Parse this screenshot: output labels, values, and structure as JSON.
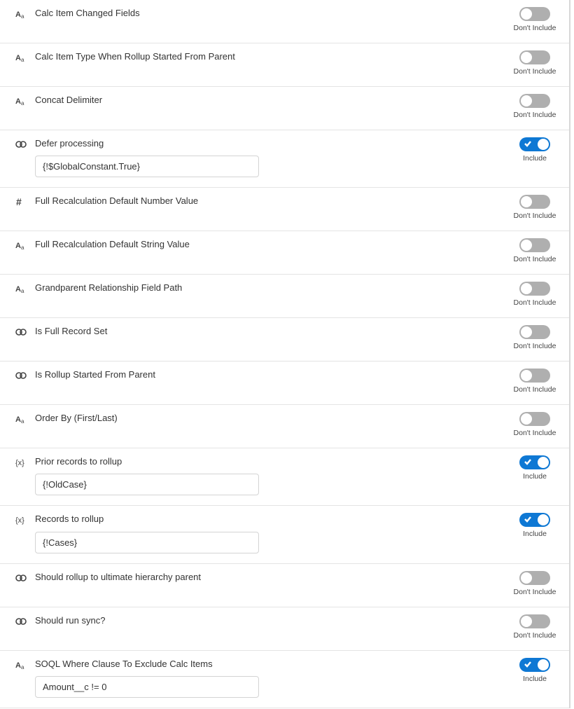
{
  "text": {
    "include": "Include",
    "dont_include": "Don't Include"
  },
  "rows": [
    {
      "icon": "text",
      "label": "Calc Item Changed Fields",
      "included": false,
      "value": null
    },
    {
      "icon": "text",
      "label": "Calc Item Type When Rollup Started From Parent",
      "included": false,
      "value": null
    },
    {
      "icon": "text",
      "label": "Concat Delimiter",
      "included": false,
      "value": null
    },
    {
      "icon": "toggle",
      "label": "Defer processing",
      "included": true,
      "value": "{!$GlobalConstant.True}"
    },
    {
      "icon": "number",
      "label": "Full Recalculation Default Number Value",
      "included": false,
      "value": null
    },
    {
      "icon": "text",
      "label": "Full Recalculation Default String Value",
      "included": false,
      "value": null
    },
    {
      "icon": "text",
      "label": "Grandparent Relationship Field Path",
      "included": false,
      "value": null
    },
    {
      "icon": "toggle",
      "label": "Is Full Record Set",
      "included": false,
      "value": null
    },
    {
      "icon": "toggle",
      "label": "Is Rollup Started From Parent",
      "included": false,
      "value": null
    },
    {
      "icon": "text",
      "label": "Order By (First/Last)",
      "included": false,
      "value": null
    },
    {
      "icon": "formula",
      "label": "Prior records to rollup",
      "included": true,
      "value": "{!OldCase}"
    },
    {
      "icon": "formula",
      "label": "Records to rollup",
      "included": true,
      "value": "{!Cases}"
    },
    {
      "icon": "toggle",
      "label": "Should rollup to ultimate hierarchy parent",
      "included": false,
      "value": null
    },
    {
      "icon": "toggle",
      "label": "Should run sync?",
      "included": false,
      "value": null
    },
    {
      "icon": "text",
      "label": "SOQL Where Clause To Exclude Calc Items",
      "included": true,
      "value": "Amount__c != 0"
    }
  ]
}
